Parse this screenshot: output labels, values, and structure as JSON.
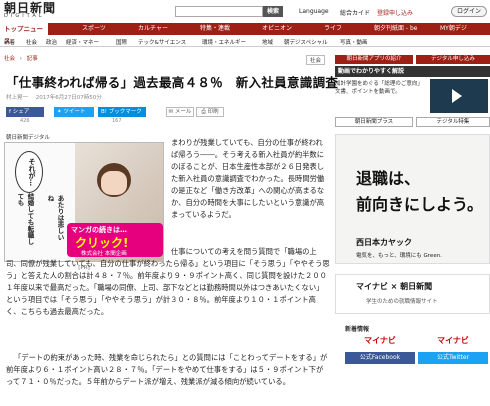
{
  "header": {
    "logo_main": "朝日新聞",
    "logo_sub": "DIGITAL",
    "search_button": "検索",
    "language": "Language",
    "top_link": "総合カイド",
    "signup": "登録申し込み",
    "login": "ログイン"
  },
  "nav_primary": {
    "active": "トップニュース",
    "items": [
      "スポーツ",
      "カルチャー",
      "特集・連載",
      "オピニオン",
      "ライフ",
      "朝夕刊紙面 - be",
      "MY朝デジ"
    ]
  },
  "nav_secondary": {
    "items": [
      "新着",
      "社会",
      "政治",
      "経済・マネー",
      "国際",
      "テック&サイエンス",
      "環境・エネルギー",
      "地域",
      "朝デジスペシャル",
      "写真・動画"
    ]
  },
  "breadcrumb": [
    "社会",
    "記事"
  ],
  "breadcrumb_tag": "社会",
  "article": {
    "title": "「仕事終われば帰る」過去最高４８％　新入社員意識調査",
    "author": "村上晃一",
    "date": "2017年6月27日07時50分",
    "share": {
      "facebook": "シェア",
      "twitter": "ツイート",
      "hatena": "ブックマーク",
      "mail": "メール",
      "print": "印刷",
      "counts": [
        "426",
        "",
        "167"
      ]
    },
    "image_source": "朝日新聞デジタル",
    "image_caption": "[PR]",
    "ad_text_1": "それが…",
    "ad_text_2": "結婚しても転職しても",
    "ad_text_3": "あたりは悲しいね",
    "ad_bubble_1": "マンガの続きは…",
    "ad_bubble_2": "クリック!",
    "ad_sponsor": "株式会社 本間企画",
    "paragraphs": [
      "まわりが残業していても、自分の仕事が終われば帰ろう――。そう考える新入社員が約半数にのぼることが、日本生産性本部が２６日発表した新入社員の意識調査でわかった。長時間労働の是正など「働き方改革」への関心が高まるなか、自分の時間を大事にしたいという意識が高まっているようだ。",
      "仕事についての考えを問う質問で「職場の上司、同僚が残業していても、自分の仕事が終わったら帰る」という項目に「そう思う」「ややそう思う」と答えた人の割合は計４８・７％。前年度より９・９ポイント高く、同じ質問を設けた２００１年度以来で最高だった。「職場の同僚、上司、部下などとは勤務時間以外はつきあいたくない」という項目では「そう思う」「ややそう思う」が計３０・８％。前年度より１０・１ポイント高く、こちらも過去最高だった。",
      "「デートの約束があった時、残業を命じられたら」との質問には「ことわってデートをする」が前年度より６・１ポイント高い２８・７％。「デートをやめて仕事をする」は５・９ポイント下がって７１・０％だった。５年前からデート派が増え、残業派が減る傾向が続いている。"
    ]
  },
  "sidebar": {
    "btn_app": "朝日新聞アプリの紹介",
    "btn_apply": "デジタル申し込み",
    "video_header": "動画でわかりやすく解説",
    "video_text": "加計学園をめぐる「総理のご意向」文書、ポイントを動画で。",
    "plus_button": "朝日新聞プラス",
    "digital_button": "テジタル特集",
    "ad_line1": "退職は、",
    "ad_line2": "前向きにしよう。",
    "ad_brand": "西日本カヤック",
    "ad_small": "電気を、もっと、環境にも Green.",
    "mnav_brand": "マイナビ × 朝日新聞",
    "mnav_sub": "学生のための就職情報サイト",
    "ad_section": "新着情報",
    "fb_label": "公式Facebook",
    "tw_label": "公式Twitter",
    "mynavi": "マイナビ"
  }
}
